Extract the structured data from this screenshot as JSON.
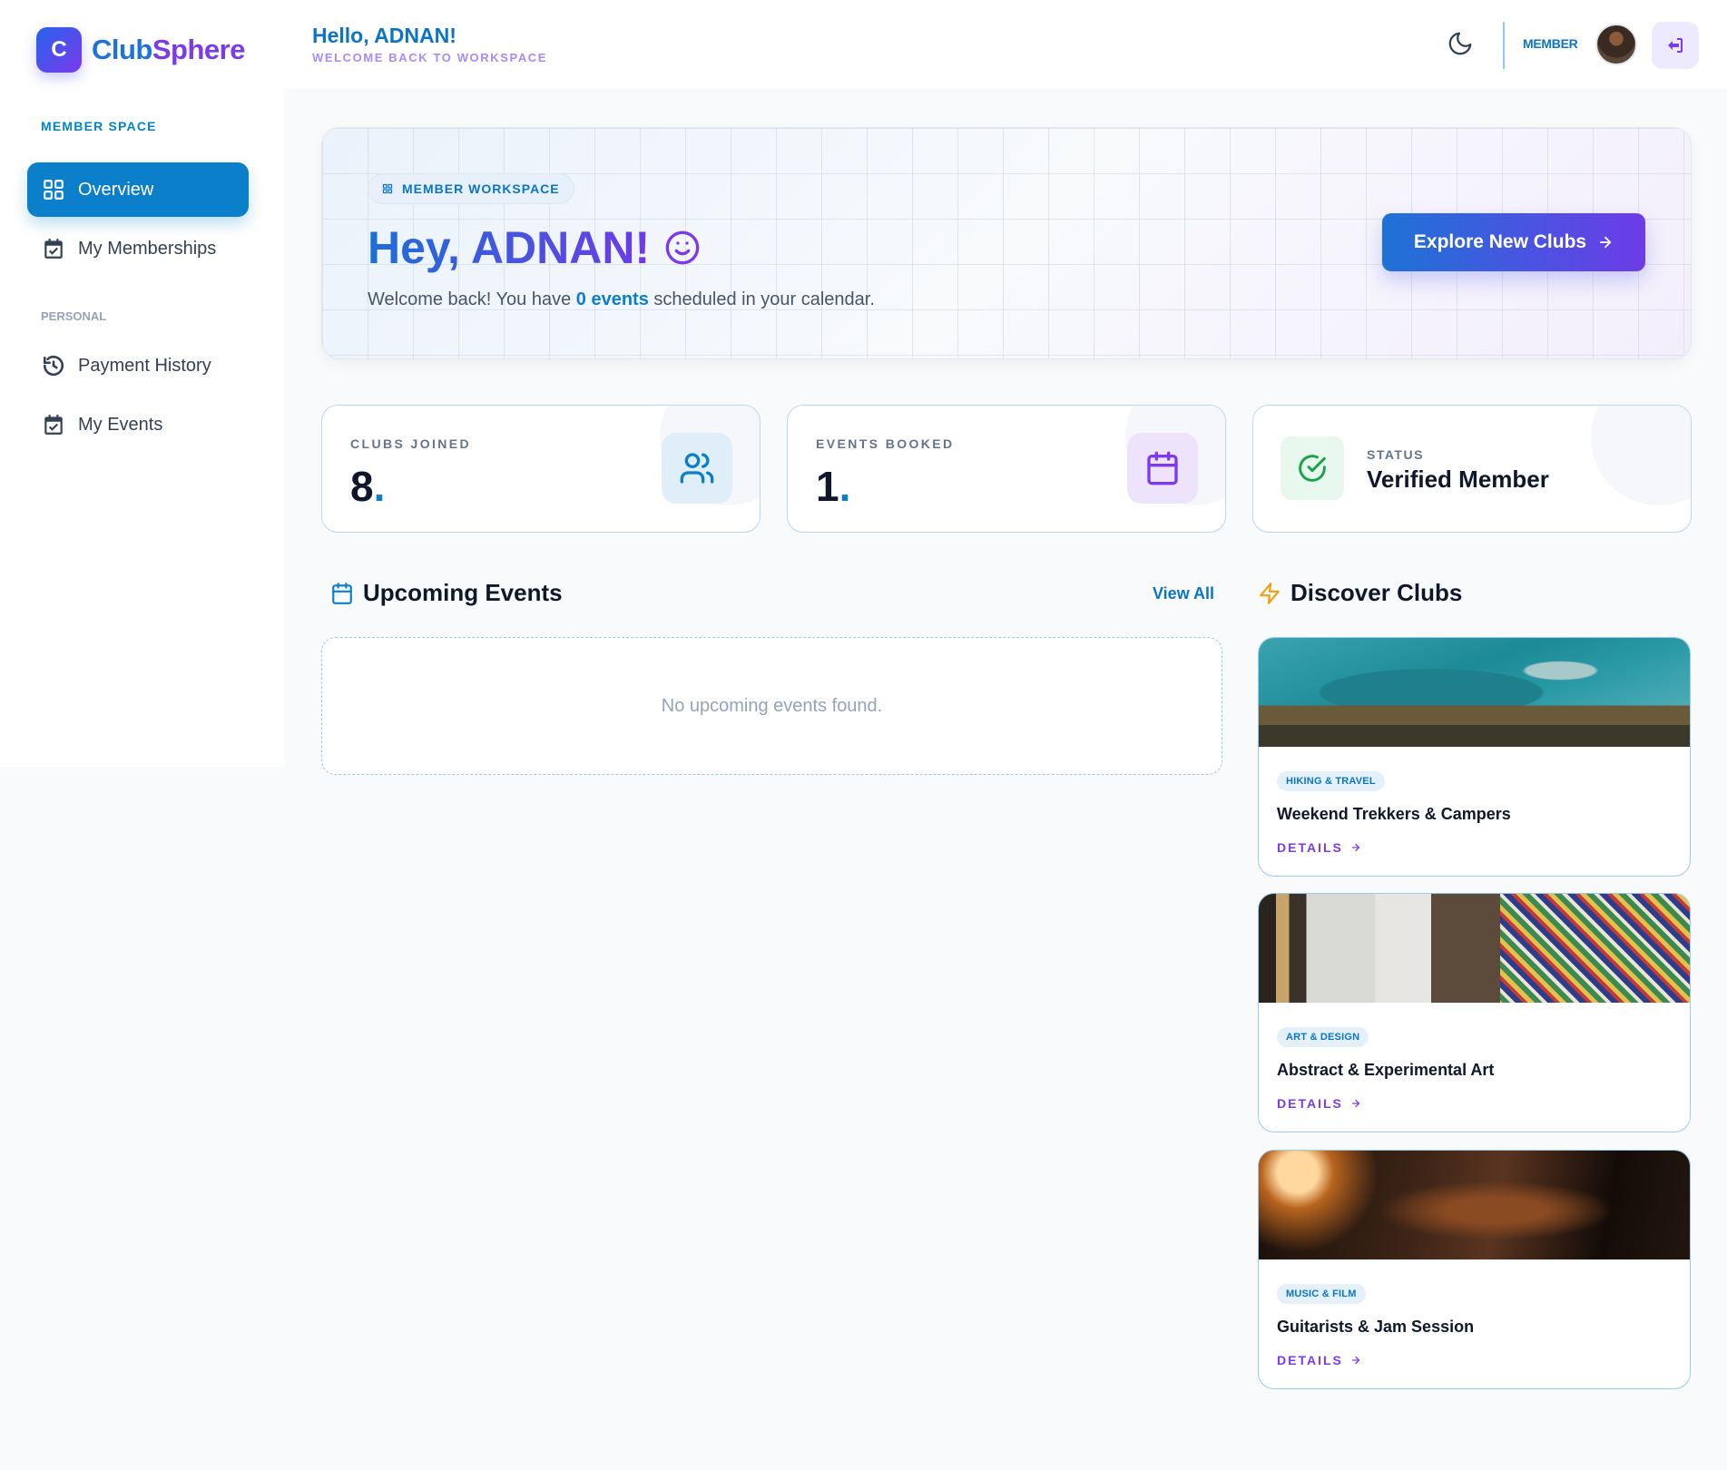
{
  "brand": {
    "logo_letter": "C",
    "name_part1": "Club",
    "name_part2": "Sphere"
  },
  "sidebar": {
    "section_member": "MEMBER SPACE",
    "section_personal": "PERSONAL",
    "items": [
      {
        "label": "Overview",
        "icon": "grid-icon",
        "active": true
      },
      {
        "label": "My Memberships",
        "icon": "calendar-check-icon"
      },
      {
        "label": "Payment History",
        "icon": "history-icon"
      },
      {
        "label": "My Events",
        "icon": "calendar-check-icon"
      }
    ]
  },
  "header": {
    "greeting": "Hello, ADNAN!",
    "subtitle": "WELCOME BACK TO WORKSPACE",
    "role": "MEMBER",
    "icons": [
      "moon-icon",
      "avatar",
      "logout-icon"
    ]
  },
  "hero": {
    "badge": "MEMBER WORKSPACE",
    "title": "Hey, ADNAN!",
    "subtitle_pre": "Welcome back! You have ",
    "subtitle_highlight": "0 events",
    "subtitle_post": " scheduled in your calendar.",
    "cta_label": "Explore New Clubs"
  },
  "stats": {
    "clubs_joined": {
      "label": "CLUBS JOINED",
      "value": "8",
      "suffix": "."
    },
    "events_booked": {
      "label": "EVENTS BOOKED",
      "value": "1",
      "suffix": "."
    },
    "status": {
      "label": "STATUS",
      "value": "Verified Member"
    }
  },
  "upcoming": {
    "title": "Upcoming Events",
    "view_all": "View All",
    "empty_text": "No upcoming events found."
  },
  "discover": {
    "title": "Discover Clubs",
    "details_label": "DETAILS",
    "clubs": [
      {
        "tag": "HIKING & TRAVEL",
        "name": "Weekend Trekkers & Campers"
      },
      {
        "tag": "ART & DESIGN",
        "name": "Abstract & Experimental Art"
      },
      {
        "tag": "MUSIC & FILM",
        "name": "Guitarists & Jam Session"
      }
    ]
  },
  "colors": {
    "primary": "#0b7fc9",
    "accent": "#7c3aed",
    "success": "#16a34a",
    "background": "#f8fafc"
  }
}
